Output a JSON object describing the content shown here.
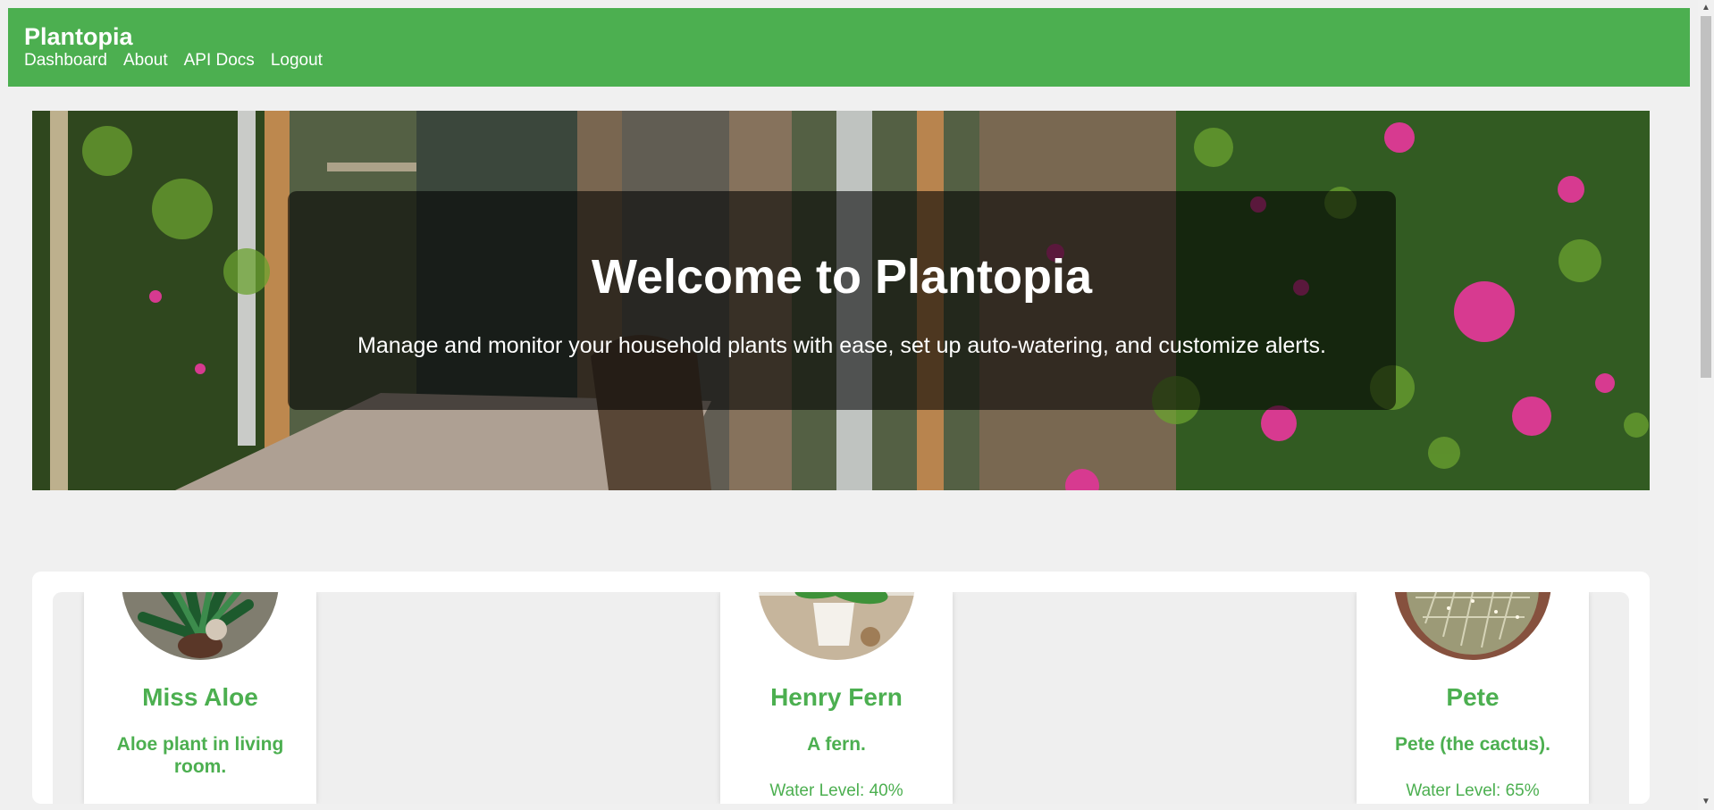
{
  "navbar": {
    "brand": "Plantopia",
    "links": [
      {
        "label": "Dashboard"
      },
      {
        "label": "About"
      },
      {
        "label": "API Docs"
      },
      {
        "label": "Logout"
      }
    ],
    "color": "#4caf50"
  },
  "hero": {
    "title": "Welcome to Plantopia",
    "subtitle": "Manage and monitor your household plants with ease, set up auto-watering, and customize alerts."
  },
  "plants": [
    {
      "name": "Miss Aloe",
      "description": "Aloe plant in living room.",
      "water_level": ""
    },
    {
      "name": "Henry Fern",
      "description": "A fern.",
      "water_level": "Water Level: 40%"
    },
    {
      "name": "Pete",
      "description": "Pete (the cactus).",
      "water_level": "Water Level: 65%"
    }
  ],
  "scrollbar": {
    "up_icon": "▲",
    "down_icon": "▼"
  }
}
